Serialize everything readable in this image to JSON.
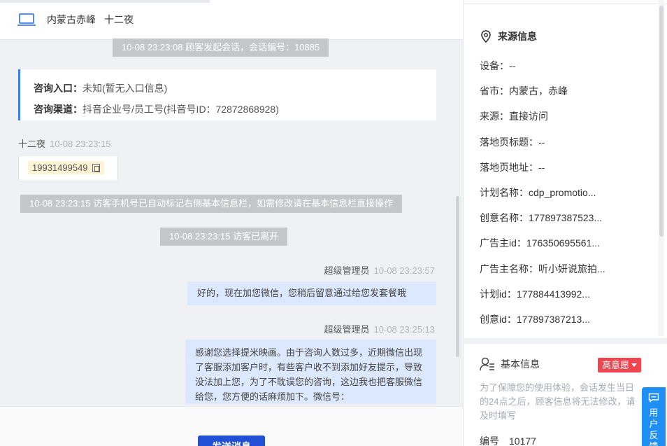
{
  "header": {
    "location": "内蒙古赤峰",
    "visitor_name": "十二夜"
  },
  "chat": {
    "session_start": "10-08 23:23:08 顾客发起会话，会话编号：10885",
    "entry_label": "咨询入口：",
    "entry_value": "未知(暂无入口信息)",
    "channel_label": "咨询渠道：",
    "channel_value": "抖音企业号/员工号(抖音号ID：72872868928)",
    "visitor_msg": {
      "sender": "十二夜",
      "time": "10-08 23:23:15",
      "phone": "19931499549"
    },
    "phone_marked_notice": "10-08 23:23:15 访客手机号已自动标记右侧基本信息栏，如需修改请在基本信息栏直接操作",
    "visitor_left_notice": "10-08 23:23:15 访客已离开",
    "agent_msg_1": {
      "sender": "超级管理员",
      "time": "10-08 23:23:57",
      "text": "好的，现在加您微信，您稍后留意通过给您发套餐哦"
    },
    "agent_msg_2": {
      "sender": "超级管理员",
      "time": "10-08 23:25:13",
      "text": "感谢您选择提米映画。由于咨询人数过多，近期微信出现了客服添加客户时，有些客户收不到添加好友提示，导致没法加上您，为了不耽误您的咨询，这边我也把客服微信给您，您方便的话麻烦加下。微信号："
    },
    "send_button": "发送消息"
  },
  "source_info": {
    "title": "来源信息",
    "items": [
      "设备：--",
      "省市：内蒙古，赤峰",
      "来源：直接访问",
      "落地页标题：--",
      "落地页地址：--",
      "计划名称：cdp_promotio...",
      "创意名称：177897387523...",
      "广告主id：176350695561...",
      "广告主名称：听小妍说旅拍...",
      "计划id：177884413992...",
      "创意id：177897387213..."
    ]
  },
  "basic_info": {
    "title": "基本信息",
    "intent": "高意愿",
    "notice": "为了保障您的使用体验，会话发生当日的24点之后，顾客信息将无法修改，请及时填写",
    "id_label": "编号",
    "id_value": "10177"
  },
  "feedback": {
    "label": "用户反馈"
  },
  "colors": {
    "accent": "#2150d6",
    "badge": "#f0444f",
    "bubble": "#dbe8fd"
  }
}
